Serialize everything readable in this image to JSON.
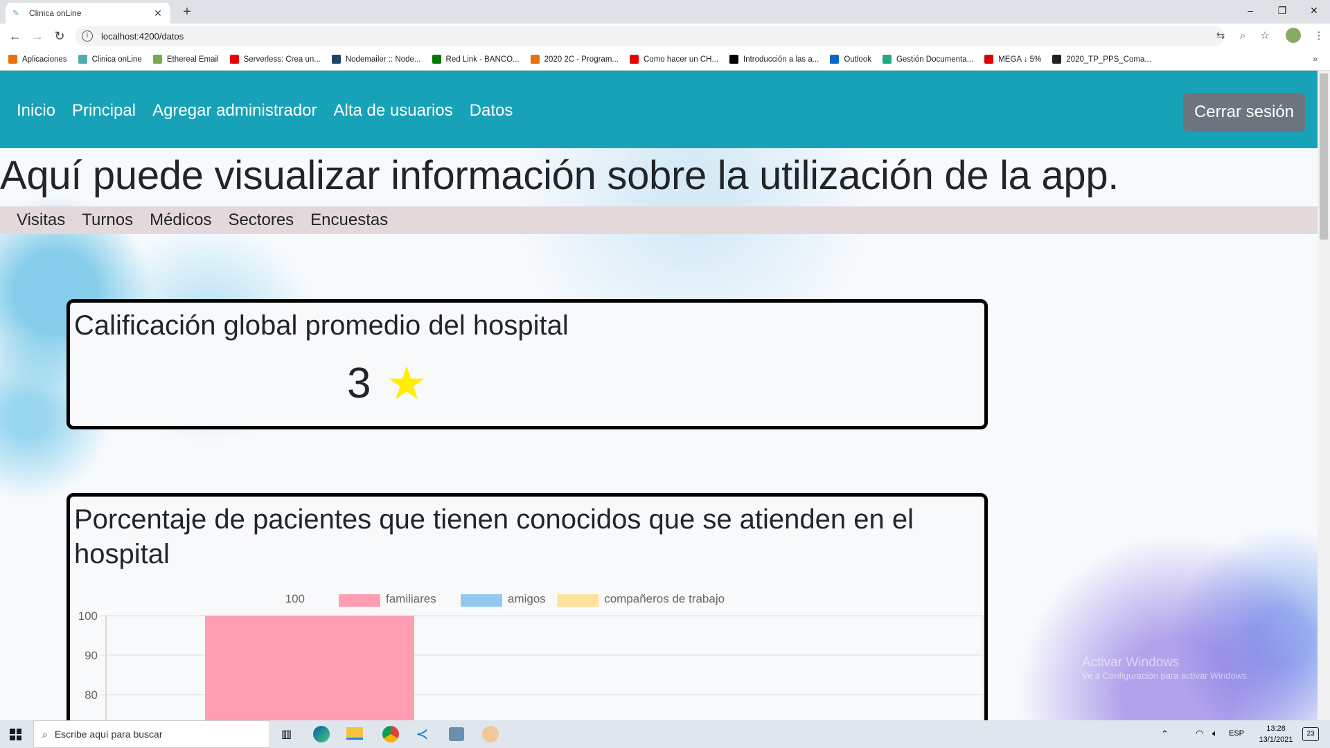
{
  "browser": {
    "tab_title": "Clinica onLine",
    "tab_favicon": "clinic-icon",
    "new_tab": "+",
    "url": "localhost:4200/datos",
    "controls": {
      "minimize": "–",
      "restore": "❐",
      "close": "✕"
    },
    "nav": {
      "back": "←",
      "forward": "→",
      "reload": "↻"
    },
    "bookmarks": [
      {
        "label": "Aplicaciones",
        "color": "#e8710a"
      },
      {
        "label": "Clinica onLine",
        "color": "#5aa"
      },
      {
        "label": "Ethereal Email",
        "color": "#7a4"
      },
      {
        "label": "Serverless: Crea un...",
        "color": "#e00"
      },
      {
        "label": "Nodemailer :: Node...",
        "color": "#246"
      },
      {
        "label": "Red Link - BANCO...",
        "color": "#070"
      },
      {
        "label": "2020 2C - Program...",
        "color": "#e8710a"
      },
      {
        "label": "Como hacer un CH...",
        "color": "#e00"
      },
      {
        "label": "Introducción a las a...",
        "color": "#000"
      },
      {
        "label": "Outlook",
        "color": "#0a64c8"
      },
      {
        "label": "Gestión Documenta...",
        "color": "#2a7"
      },
      {
        "label": "MEGA ↓ 5%",
        "color": "#d00"
      },
      {
        "label": "2020_TP_PPS_Coma...",
        "color": "#222"
      }
    ],
    "bookmarks_more": "»"
  },
  "navbar": {
    "links": [
      "Inicio",
      "Principal",
      "Agregar administrador",
      "Alta de usuarios",
      "Datos"
    ],
    "logout": "Cerrar sesión"
  },
  "headline": "Aquí puede visualizar información sobre la utilización de la app.",
  "subnav": [
    "Visitas",
    "Turnos",
    "Médicos",
    "Sectores",
    "Encuestas"
  ],
  "rating_card": {
    "title": "Calificación global promedio del hospital",
    "value": "3",
    "star": "★"
  },
  "chart_card": {
    "title": "Porcentaje de pacientes que tienen conocidos que se atienden en el hospital"
  },
  "chart_data": {
    "type": "bar",
    "title": "100",
    "legend_position": "top",
    "series": [
      {
        "name": "familiares",
        "values": [
          100
        ],
        "color": "#ff9eb3"
      },
      {
        "name": "amigos",
        "values": [
          0
        ],
        "color": "#93c9f0"
      },
      {
        "name": "compañeros de trabajo",
        "values": [
          0
        ],
        "color": "#ffe29a"
      }
    ],
    "y_ticks": [
      100,
      90,
      80
    ],
    "ylim": [
      0,
      100
    ],
    "grid": true
  },
  "taskbar": {
    "search_placeholder": "Escribe aquí para buscar",
    "language": "ESP",
    "time": "13:28",
    "date": "13/1/2021",
    "notifications": "23"
  },
  "watermark": {
    "line1": "Activar Windows",
    "line2": "Ve a Configuración para activar Windows."
  }
}
